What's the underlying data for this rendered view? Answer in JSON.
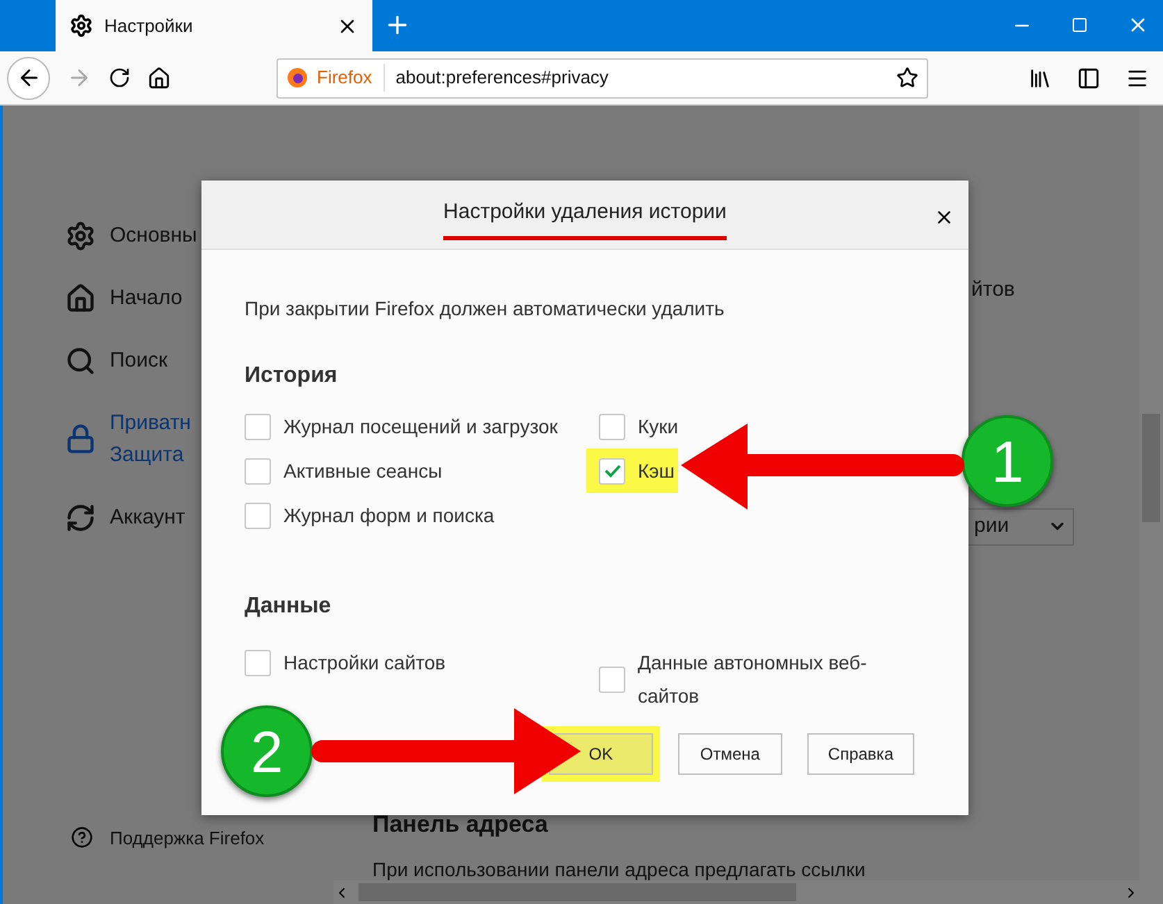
{
  "browser": {
    "tab": {
      "title": "Настройки"
    },
    "address_bar": {
      "identity": "Firefox",
      "url": "about:preferences#privacy"
    }
  },
  "sidebar": {
    "items": [
      {
        "lines": [
          "Основны"
        ],
        "selected": false
      },
      {
        "lines": [
          "Начало"
        ],
        "selected": false
      },
      {
        "lines": [
          "Поиск"
        ],
        "selected": false
      },
      {
        "lines": [
          "Приватн",
          "Защита"
        ],
        "selected": true
      },
      {
        "lines": [
          "Аккаунт"
        ],
        "selected": false
      }
    ],
    "support_link": "Поддержка Firefox"
  },
  "page": {
    "fragment": "йтов",
    "dropdown": {
      "value": "рии"
    },
    "heading": "Панель адреса",
    "paragraph": "При использовании панели адреса предлагать ссылки"
  },
  "dialog": {
    "title": "Настройки удаления истории",
    "title_underlined": true,
    "description": "При закрытии Firefox должен автоматически удалить",
    "sections": [
      {
        "heading": "История",
        "options": [
          {
            "label": "Журнал посещений и загрузок",
            "checked": false,
            "highlighted": false
          },
          {
            "label": "Куки",
            "checked": false,
            "highlighted": false
          },
          {
            "label": "Активные сеансы",
            "checked": false,
            "highlighted": false
          },
          {
            "label": "Кэш",
            "checked": true,
            "highlighted": true
          },
          {
            "label": "Журнал форм и поиска",
            "checked": false,
            "highlighted": false
          }
        ]
      },
      {
        "heading": "Данные",
        "options": [
          {
            "label": "Настройки сайтов",
            "checked": false,
            "highlighted": false
          },
          {
            "label": "Данные автономных веб-сайтов",
            "checked": false,
            "highlighted": false
          }
        ]
      }
    ],
    "buttons": [
      {
        "label": "OK",
        "highlighted": true
      },
      {
        "label": "Отмена",
        "highlighted": false
      },
      {
        "label": "Справка",
        "highlighted": false
      }
    ]
  },
  "callouts": [
    {
      "number": "1"
    },
    {
      "number": "2"
    }
  ]
}
